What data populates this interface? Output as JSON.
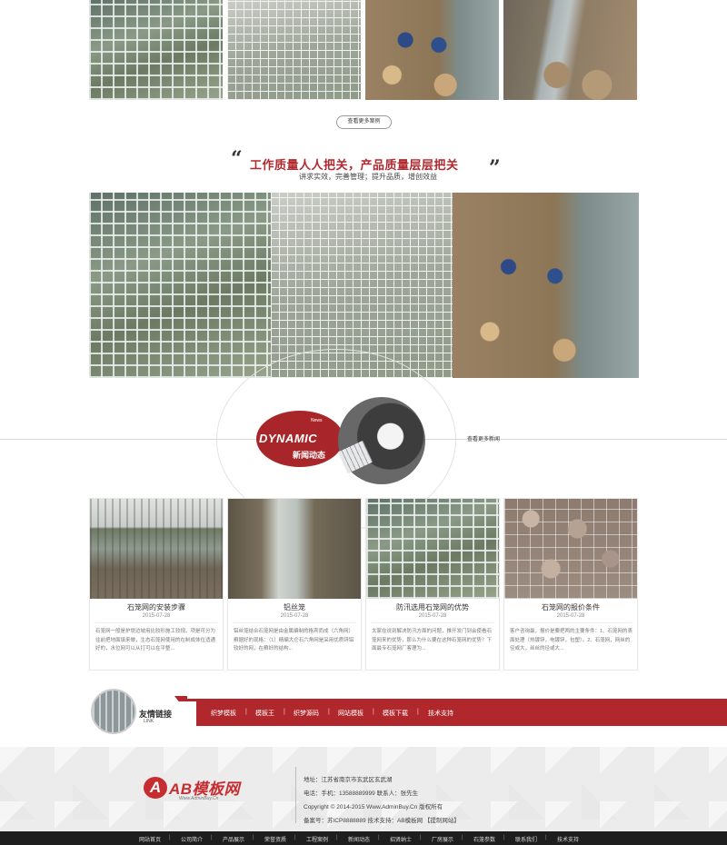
{
  "cases": {
    "more_label": "查看更多案例",
    "photos": [
      "gabion-mesh-photo",
      "gabion-box-photo",
      "workers-photo",
      "river-bank-photo"
    ]
  },
  "quality": {
    "quote_open": "“",
    "quote_close": "”",
    "slogan": "工作质量人人把关，产品质量层层把关",
    "subtitle": "讲求实效，完善管理；提升品质，增创效益"
  },
  "news": {
    "badge_small": "News",
    "badge_en": "DYNAMIC",
    "badge_cn": "新闻动态",
    "more_label": "查看更多新闻",
    "items": [
      {
        "title": "石笼网的安装步骤",
        "date": "2015-07-28",
        "desc": "石笼网一般是护堤边坡用比较形施工较规。项是可分为往前把地面填来做，生态石笼网使用的在制成体位适通好的，水位网可以从打可以在平整..."
      },
      {
        "title": "铝丝笼",
        "date": "2015-07-28",
        "desc": "铝丝笼结合石笼网是由金属编制的格宾而成（六角网）粮据好的现格：（1）精编大仑石六角网是采用优质锌铝较好的网，在粮好的结构..."
      },
      {
        "title": "防汛选用石笼网的优势",
        "date": "2015-07-28",
        "desc": "太家在说到解决防汛方面的问题，推开发门到会使看石笼网来的优势，那么为什么要在这种石笼网的优势？下面最专石笼网厂客理为..."
      },
      {
        "title": "石笼网的报价条件",
        "date": "2015-07-28",
        "desc": "客户咨询最，报价是要把两的主要条件：1、石笼网的表面处理（热镀锌，电镀锌，包塑）。2、石笼网，网丝的径或大，丝丝的径或大..."
      }
    ]
  },
  "links": {
    "title": "友情链接",
    "subtitle": "LINK",
    "items": [
      "织梦模板",
      "模板王",
      "织梦源码",
      "网站模板",
      "模板下载",
      "技术支持"
    ]
  },
  "footer": {
    "logo_mark": "A",
    "logo_text": "AB模板网",
    "logo_sub": "Www.AdminBuy.Cn",
    "address": "地址：江苏省南京市玄武区玄武湖",
    "phone": "电话：手机：13588889999  联系人：张先生",
    "copyright": "Copyright © 2014-2015 Www.AdminBuy.Cn 版权所有",
    "icp": "备案号：苏ICP8888889    技术支持：AB模板网  【提制网站】"
  },
  "bottom_nav": [
    "网站首页",
    "公司简介",
    "产品展示",
    "荣誉资质",
    "工程案例",
    "新闻动态",
    "招贤纳士",
    "厂房展示",
    "石笼参数",
    "联系我们",
    "技术支持"
  ]
}
